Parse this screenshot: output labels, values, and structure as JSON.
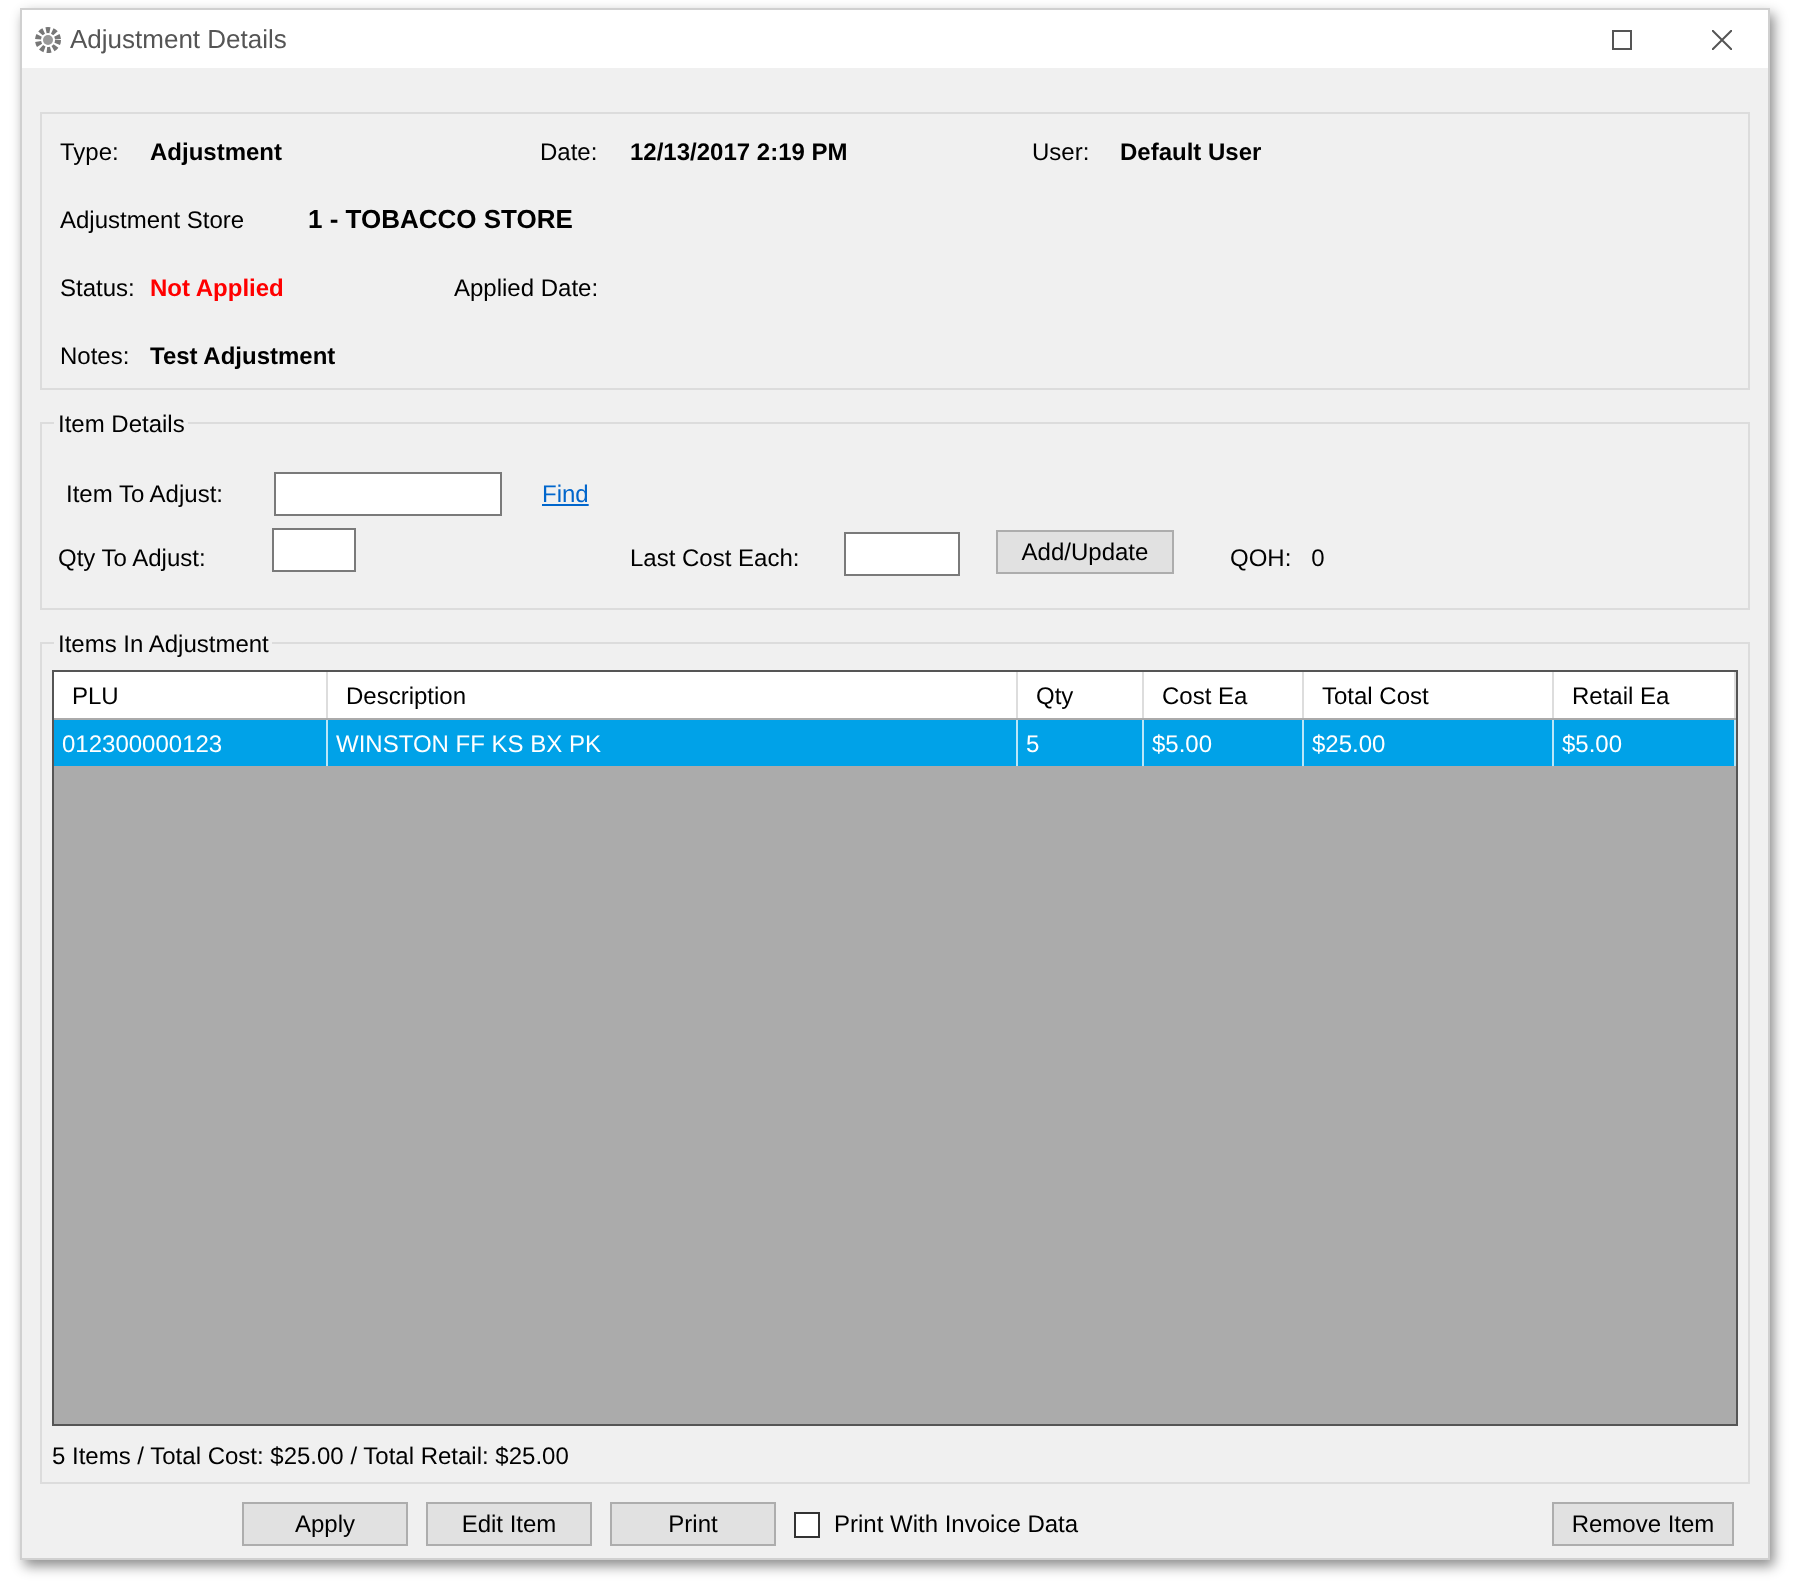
{
  "window": {
    "title": "Adjustment Details"
  },
  "header": {
    "type_label": "Type:",
    "type": "Adjustment",
    "date_label": "Date:",
    "date": "12/13/2017 2:19 PM",
    "user_label": "User:",
    "user": "Default User",
    "store_label": "Adjustment Store",
    "store": "1 - TOBACCO STORE",
    "status_label": "Status:",
    "status": {
      "text": "Not Applied",
      "applied": false
    },
    "applied_date_label": "Applied Date:",
    "notes_label": "Notes:",
    "notes": "Test Adjustment"
  },
  "item_details": {
    "legend": "Item Details",
    "item_label": "Item To Adjust:",
    "find_link": "Find",
    "qty_label": "Qty To Adjust:",
    "cost_label": "Last Cost Each:",
    "add_button": "Add/Update",
    "qoh_label": "QOH:",
    "qoh": "0"
  },
  "items": {
    "legend": "Items In Adjustment",
    "columns": [
      "PLU",
      "Description",
      "Qty",
      "Cost Ea",
      "Total Cost",
      "Retail Ea"
    ],
    "rows": [
      {
        "cells": [
          "012300000123",
          "WINSTON FF KS BX PK",
          "5",
          "$5.00",
          "$25.00",
          "$5.00"
        ],
        "selected": true
      }
    ],
    "summary": "5 Items / Total Cost: $25.00 / Total Retail: $25.00"
  },
  "buttons": [
    "Apply",
    "Edit Item",
    "Print"
  ],
  "print_invoice": {
    "label": "Print With Invoice Data",
    "checked": false
  },
  "remove_button": "Remove Item"
}
